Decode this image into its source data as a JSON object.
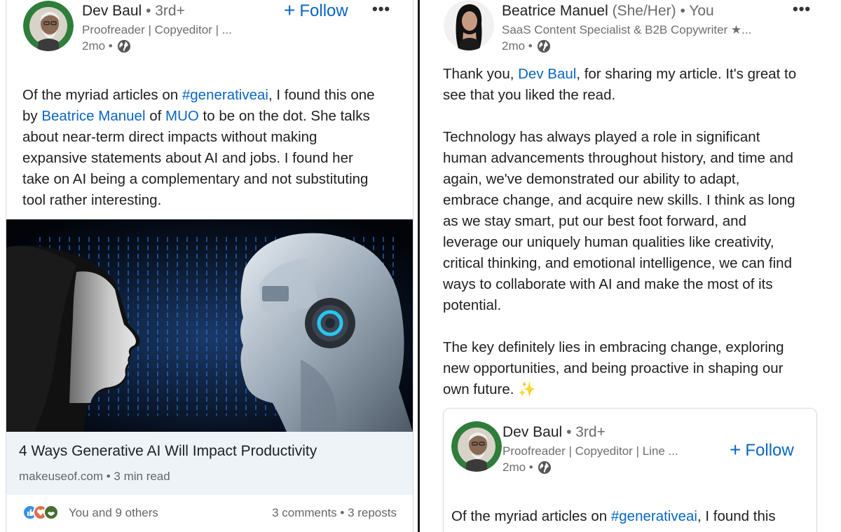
{
  "left_post": {
    "author": {
      "name": "Dev Baul",
      "degree": "• 3rd+",
      "headline": "Proofreader | Copyeditor | ...",
      "time": "2mo •"
    },
    "follow_label": "Follow",
    "more_label": "•••",
    "body_lines": [
      {
        "parts": [
          {
            "t": "Of the myriad articles on "
          },
          {
            "t": "#generativeai",
            "link": true
          },
          {
            "t": ", I found this one"
          }
        ]
      },
      {
        "parts": [
          {
            "t": "by "
          },
          {
            "t": "Beatrice Manuel",
            "link": true
          },
          {
            "t": " of "
          },
          {
            "t": "MUO",
            "link": true
          },
          {
            "t": " to be on the dot. She talks"
          }
        ]
      },
      {
        "parts": [
          {
            "t": "about near-term direct impacts without making"
          }
        ]
      },
      {
        "parts": [
          {
            "t": "expansive statements about AI and jobs. I found her"
          }
        ]
      },
      {
        "parts": [
          {
            "t": "take on AI being a complementary and not substituting"
          }
        ]
      },
      {
        "parts": [
          {
            "t": "tool rather interesting."
          }
        ]
      }
    ],
    "article": {
      "title": "4 Ways Generative AI Will Impact Productivity",
      "source": "makeuseof.com • 3 min read"
    },
    "social": {
      "reactions_text": "You and 9 others",
      "counts_text": "3 comments • 3 reposts"
    }
  },
  "right_post": {
    "author": {
      "name": "Beatrice Manuel",
      "pronoun": "(She/Her)",
      "you": "• You",
      "headline": "SaaS Content Specialist & B2B Copywriter ★...",
      "time": "2mo •"
    },
    "more_label": "•••",
    "body_lines": [
      {
        "parts": [
          {
            "t": "Thank you, "
          },
          {
            "t": "Dev Baul",
            "link": true
          },
          {
            "t": ", for sharing my article. It's great to"
          }
        ]
      },
      {
        "parts": [
          {
            "t": "see that you liked the read."
          }
        ]
      },
      {
        "parts": [
          {
            "t": ""
          }
        ]
      },
      {
        "parts": [
          {
            "t": "Technology has always played a role in significant"
          }
        ]
      },
      {
        "parts": [
          {
            "t": "human advancements throughout history, and time and"
          }
        ]
      },
      {
        "parts": [
          {
            "t": "again, we've demonstrated our ability to adapt,"
          }
        ]
      },
      {
        "parts": [
          {
            "t": "embrace change, and acquire new skills. I think as long"
          }
        ]
      },
      {
        "parts": [
          {
            "t": "as we stay smart, put our best foot forward, and"
          }
        ]
      },
      {
        "parts": [
          {
            "t": "leverage our uniquely human qualities like creativity,"
          }
        ]
      },
      {
        "parts": [
          {
            "t": "critical thinking, and emotional intelligence, we can find"
          }
        ]
      },
      {
        "parts": [
          {
            "t": "ways to collaborate with AI and make the most of its"
          }
        ]
      },
      {
        "parts": [
          {
            "t": "potential."
          }
        ]
      },
      {
        "parts": [
          {
            "t": ""
          }
        ]
      },
      {
        "parts": [
          {
            "t": "The key definitely lies in embracing change, exploring"
          }
        ]
      },
      {
        "parts": [
          {
            "t": "new opportunities, and being proactive in shaping our"
          }
        ]
      },
      {
        "parts": [
          {
            "t": "own future. "
          },
          {
            "t": "✨",
            "emoji": true
          }
        ]
      }
    ],
    "quoted": {
      "author": {
        "name": "Dev Baul",
        "degree": "• 3rd+",
        "headline": "Proofreader | Copyeditor | Line ...",
        "time": "2mo •"
      },
      "follow_label": "Follow",
      "body_first_line": [
        {
          "t": "Of the myriad articles on "
        },
        {
          "t": "#generativeai",
          "link": true
        },
        {
          "t": ", I found this"
        }
      ]
    }
  },
  "colors": {
    "link": "#0a66c2",
    "muted": "#6e6e6e",
    "article_footer_bg": "#eef3f8",
    "divider": "#1b1b1b"
  },
  "icons": [
    "globe-icon",
    "plus-icon",
    "more-options-icon",
    "like-reaction-icon",
    "love-reaction-icon",
    "support-reaction-icon",
    "sparkles-emoji"
  ]
}
